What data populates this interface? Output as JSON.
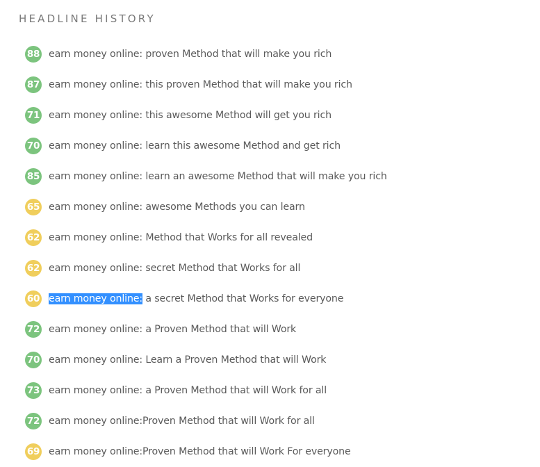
{
  "section": {
    "title": "HEADLINE HISTORY"
  },
  "colors": {
    "high_score": "#7cc47e",
    "medium_score": "#f0ce5c",
    "selection": "#3390ff"
  },
  "headlines": [
    {
      "score": 88,
      "level": "green",
      "text": "earn money online: proven Method that will make you rich"
    },
    {
      "score": 87,
      "level": "green",
      "text": "earn money online: this proven Method that will make you rich"
    },
    {
      "score": 71,
      "level": "green",
      "text": "earn money online: this awesome Method will get you rich"
    },
    {
      "score": 70,
      "level": "green",
      "text": "earn money online: learn this awesome Method and get rich"
    },
    {
      "score": 85,
      "level": "green",
      "text": "earn money online: learn an awesome Method that will make you rich"
    },
    {
      "score": 65,
      "level": "yellow",
      "text": "earn money online: awesome Methods you can learn"
    },
    {
      "score": 62,
      "level": "yellow",
      "text": "earn money online: Method that Works for all revealed"
    },
    {
      "score": 62,
      "level": "yellow",
      "text": "earn money online: secret Method that Works for all"
    },
    {
      "score": 60,
      "level": "yellow",
      "text": "earn money online: a secret Method that Works for everyone",
      "selected_text": "earn money online:",
      "rest_text": " a secret Method that Works for everyone"
    },
    {
      "score": 72,
      "level": "green",
      "text": "earn money online: a Proven Method that will Work"
    },
    {
      "score": 70,
      "level": "green",
      "text": "earn money online: Learn a Proven Method that will Work"
    },
    {
      "score": 73,
      "level": "green",
      "text": "earn money online: a Proven Method that will Work for all"
    },
    {
      "score": 72,
      "level": "green",
      "text": "earn money online:Proven Method that will Work for all"
    },
    {
      "score": 69,
      "level": "yellow",
      "text": "earn money online:Proven Method that will Work For everyone"
    }
  ]
}
